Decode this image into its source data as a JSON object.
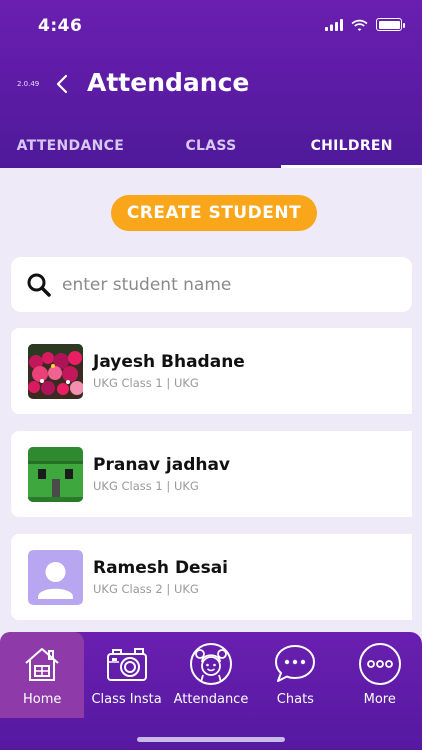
{
  "status_bar": {
    "time": "4:46"
  },
  "header": {
    "version": "2.0.49",
    "title": "Attendance"
  },
  "tabs": [
    {
      "label": "ATTENDANCE",
      "active": false
    },
    {
      "label": "CLASS",
      "active": false
    },
    {
      "label": "CHILDREN",
      "active": true
    }
  ],
  "create_button": {
    "label": "CREATE STUDENT"
  },
  "search": {
    "placeholder": "enter student name",
    "value": ""
  },
  "students": [
    {
      "name": "Jayesh  Bhadane",
      "class": "UKG Class 1 | UKG",
      "avatar": "flowers-photo"
    },
    {
      "name": "Pranav jadhav",
      "class": "UKG Class 1 | UKG",
      "avatar": "green-block-photo"
    },
    {
      "name": "Ramesh Desai",
      "class": "UKG Class 2 | UKG",
      "avatar": "default-person-icon"
    }
  ],
  "bottom_nav": [
    {
      "label": "Home",
      "icon": "house-icon",
      "active": true
    },
    {
      "label": "Class Insta",
      "icon": "camera-icon",
      "active": false
    },
    {
      "label": "Attendance",
      "icon": "child-face-icon",
      "active": false
    },
    {
      "label": "Chats",
      "icon": "chat-bubble-icon",
      "active": false
    },
    {
      "label": "More",
      "icon": "more-dots-icon",
      "active": false
    }
  ],
  "colors": {
    "primary": "#5a1ba3",
    "accent": "#f9a61a",
    "active_nav": "#8e3aa8",
    "background": "#efeaf8"
  }
}
